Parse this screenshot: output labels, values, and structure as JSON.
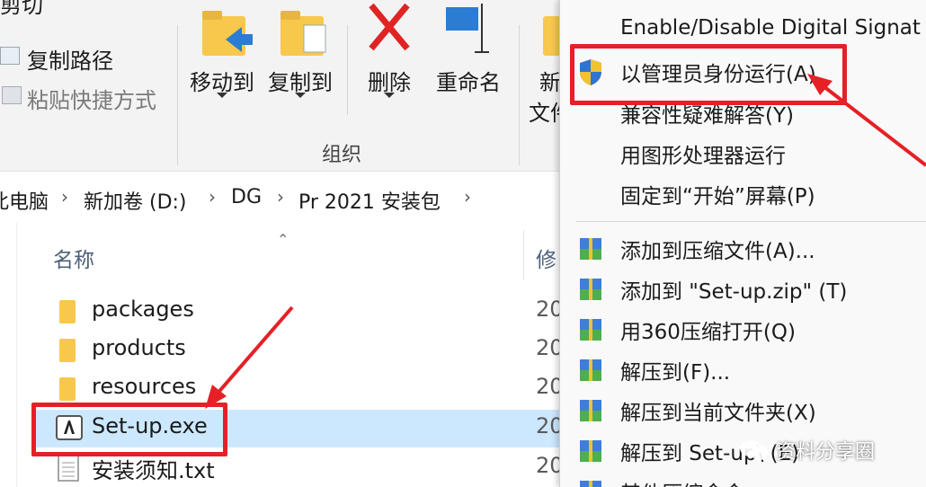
{
  "ribbon": {
    "top_partial_label": "剪切",
    "copy_path": "复制路径",
    "paste_shortcut": "粘贴快捷方式",
    "move_to": "移动到",
    "copy_to": "复制到",
    "delete": "删除",
    "rename": "重命名",
    "new_folder_partial_1": "新",
    "new_folder_partial_2": "文件",
    "group_label": "组织"
  },
  "address": {
    "crumbs": [
      "此电脑",
      "新加卷 (D:)",
      "DG",
      "Pr 2021 安装包"
    ]
  },
  "columns": {
    "name": "名称",
    "modified": "修"
  },
  "files": [
    {
      "name": "packages",
      "type": "folder",
      "date": "20"
    },
    {
      "name": "products",
      "type": "folder",
      "date": "20"
    },
    {
      "name": "resources",
      "type": "folder",
      "date": "20"
    },
    {
      "name": "Set-up.exe",
      "type": "exe",
      "date": "20",
      "selected": true
    },
    {
      "name": "安装须知.txt",
      "type": "txt",
      "date": "20"
    }
  ],
  "context_menu": {
    "items": [
      {
        "label": "Enable/Disable Digital Signat",
        "icon": ""
      },
      {
        "label": "以管理员身份运行(A)",
        "icon": "uac-shield-icon"
      },
      {
        "label": "兼容性疑难解答(Y)",
        "icon": ""
      },
      {
        "label": "用图形处理器运行",
        "icon": ""
      },
      {
        "label": "固定到“开始”屏幕(P)",
        "icon": ""
      },
      {
        "label": "添加到压缩文件(A)...",
        "icon": "archive-icon"
      },
      {
        "label": "添加到 \"Set-up.zip\" (T)",
        "icon": "archive-icon"
      },
      {
        "label": "用360压缩打开(Q)",
        "icon": "archive-icon"
      },
      {
        "label": "解压到(F)...",
        "icon": "archive-icon"
      },
      {
        "label": "解压到当前文件夹(X)",
        "icon": "archive-icon"
      },
      {
        "label": "解压到 Set-up\\ (E)",
        "icon": "archive-icon"
      },
      {
        "label": "其他压缩命令",
        "icon": "archive-icon"
      }
    ]
  },
  "watermark": "资料分享圈",
  "colors": {
    "highlight": "#e52026",
    "selection": "#cce8ff",
    "folder": "#f7c84c"
  }
}
